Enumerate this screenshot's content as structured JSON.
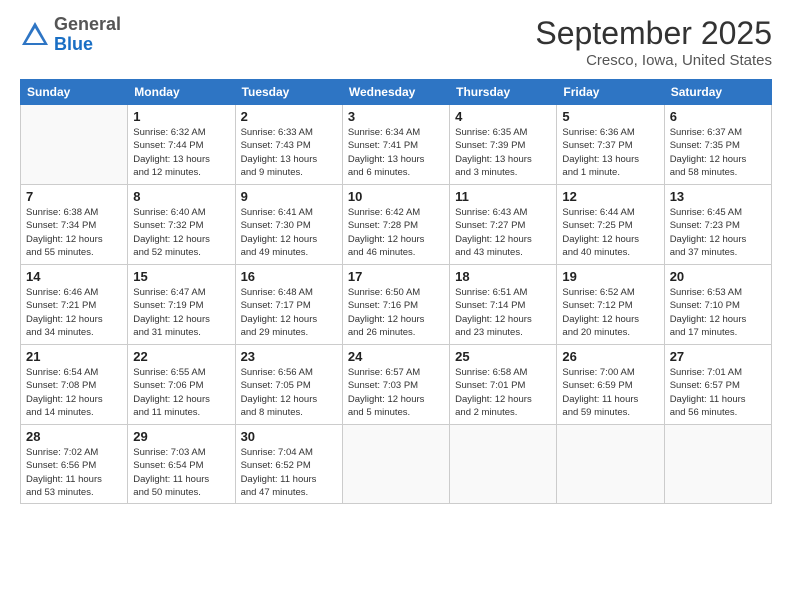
{
  "header": {
    "logo": {
      "general": "General",
      "blue": "Blue"
    },
    "title": "September 2025",
    "location": "Cresco, Iowa, United States"
  },
  "weekdays": [
    "Sunday",
    "Monday",
    "Tuesday",
    "Wednesday",
    "Thursday",
    "Friday",
    "Saturday"
  ],
  "weeks": [
    [
      {
        "day": "",
        "info": ""
      },
      {
        "day": "1",
        "info": "Sunrise: 6:32 AM\nSunset: 7:44 PM\nDaylight: 13 hours\nand 12 minutes."
      },
      {
        "day": "2",
        "info": "Sunrise: 6:33 AM\nSunset: 7:43 PM\nDaylight: 13 hours\nand 9 minutes."
      },
      {
        "day": "3",
        "info": "Sunrise: 6:34 AM\nSunset: 7:41 PM\nDaylight: 13 hours\nand 6 minutes."
      },
      {
        "day": "4",
        "info": "Sunrise: 6:35 AM\nSunset: 7:39 PM\nDaylight: 13 hours\nand 3 minutes."
      },
      {
        "day": "5",
        "info": "Sunrise: 6:36 AM\nSunset: 7:37 PM\nDaylight: 13 hours\nand 1 minute."
      },
      {
        "day": "6",
        "info": "Sunrise: 6:37 AM\nSunset: 7:35 PM\nDaylight: 12 hours\nand 58 minutes."
      }
    ],
    [
      {
        "day": "7",
        "info": "Sunrise: 6:38 AM\nSunset: 7:34 PM\nDaylight: 12 hours\nand 55 minutes."
      },
      {
        "day": "8",
        "info": "Sunrise: 6:40 AM\nSunset: 7:32 PM\nDaylight: 12 hours\nand 52 minutes."
      },
      {
        "day": "9",
        "info": "Sunrise: 6:41 AM\nSunset: 7:30 PM\nDaylight: 12 hours\nand 49 minutes."
      },
      {
        "day": "10",
        "info": "Sunrise: 6:42 AM\nSunset: 7:28 PM\nDaylight: 12 hours\nand 46 minutes."
      },
      {
        "day": "11",
        "info": "Sunrise: 6:43 AM\nSunset: 7:27 PM\nDaylight: 12 hours\nand 43 minutes."
      },
      {
        "day": "12",
        "info": "Sunrise: 6:44 AM\nSunset: 7:25 PM\nDaylight: 12 hours\nand 40 minutes."
      },
      {
        "day": "13",
        "info": "Sunrise: 6:45 AM\nSunset: 7:23 PM\nDaylight: 12 hours\nand 37 minutes."
      }
    ],
    [
      {
        "day": "14",
        "info": "Sunrise: 6:46 AM\nSunset: 7:21 PM\nDaylight: 12 hours\nand 34 minutes."
      },
      {
        "day": "15",
        "info": "Sunrise: 6:47 AM\nSunset: 7:19 PM\nDaylight: 12 hours\nand 31 minutes."
      },
      {
        "day": "16",
        "info": "Sunrise: 6:48 AM\nSunset: 7:17 PM\nDaylight: 12 hours\nand 29 minutes."
      },
      {
        "day": "17",
        "info": "Sunrise: 6:50 AM\nSunset: 7:16 PM\nDaylight: 12 hours\nand 26 minutes."
      },
      {
        "day": "18",
        "info": "Sunrise: 6:51 AM\nSunset: 7:14 PM\nDaylight: 12 hours\nand 23 minutes."
      },
      {
        "day": "19",
        "info": "Sunrise: 6:52 AM\nSunset: 7:12 PM\nDaylight: 12 hours\nand 20 minutes."
      },
      {
        "day": "20",
        "info": "Sunrise: 6:53 AM\nSunset: 7:10 PM\nDaylight: 12 hours\nand 17 minutes."
      }
    ],
    [
      {
        "day": "21",
        "info": "Sunrise: 6:54 AM\nSunset: 7:08 PM\nDaylight: 12 hours\nand 14 minutes."
      },
      {
        "day": "22",
        "info": "Sunrise: 6:55 AM\nSunset: 7:06 PM\nDaylight: 12 hours\nand 11 minutes."
      },
      {
        "day": "23",
        "info": "Sunrise: 6:56 AM\nSunset: 7:05 PM\nDaylight: 12 hours\nand 8 minutes."
      },
      {
        "day": "24",
        "info": "Sunrise: 6:57 AM\nSunset: 7:03 PM\nDaylight: 12 hours\nand 5 minutes."
      },
      {
        "day": "25",
        "info": "Sunrise: 6:58 AM\nSunset: 7:01 PM\nDaylight: 12 hours\nand 2 minutes."
      },
      {
        "day": "26",
        "info": "Sunrise: 7:00 AM\nSunset: 6:59 PM\nDaylight: 11 hours\nand 59 minutes."
      },
      {
        "day": "27",
        "info": "Sunrise: 7:01 AM\nSunset: 6:57 PM\nDaylight: 11 hours\nand 56 minutes."
      }
    ],
    [
      {
        "day": "28",
        "info": "Sunrise: 7:02 AM\nSunset: 6:56 PM\nDaylight: 11 hours\nand 53 minutes."
      },
      {
        "day": "29",
        "info": "Sunrise: 7:03 AM\nSunset: 6:54 PM\nDaylight: 11 hours\nand 50 minutes."
      },
      {
        "day": "30",
        "info": "Sunrise: 7:04 AM\nSunset: 6:52 PM\nDaylight: 11 hours\nand 47 minutes."
      },
      {
        "day": "",
        "info": ""
      },
      {
        "day": "",
        "info": ""
      },
      {
        "day": "",
        "info": ""
      },
      {
        "day": "",
        "info": ""
      }
    ]
  ]
}
